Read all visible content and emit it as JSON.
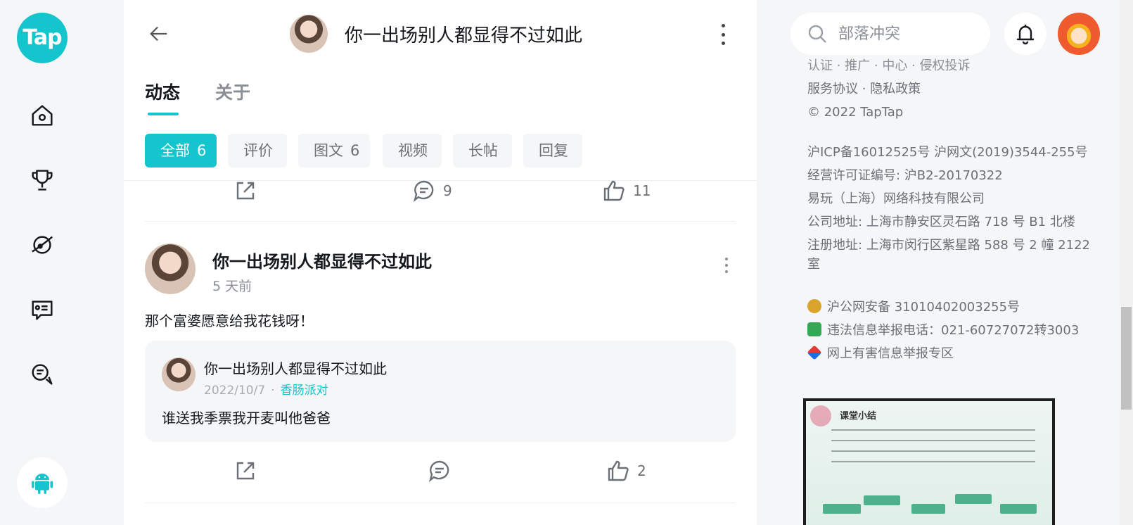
{
  "rail": {
    "logo_text": "Tap",
    "items": [
      {
        "icon": "home-icon"
      },
      {
        "icon": "trophy-icon"
      },
      {
        "icon": "planet-icon"
      },
      {
        "icon": "message-card-icon"
      },
      {
        "icon": "chat-bubbles-icon"
      }
    ],
    "download_icon": "android-icon"
  },
  "header": {
    "title": "你一出场别人都显得不过如此"
  },
  "tabs": [
    {
      "label": "动态",
      "active": true
    },
    {
      "label": "关于",
      "active": false
    }
  ],
  "filters": [
    {
      "label": "全部",
      "count": "6",
      "active": true
    },
    {
      "label": "评价",
      "count": ""
    },
    {
      "label": "图文",
      "count": "6"
    },
    {
      "label": "视频",
      "count": ""
    },
    {
      "label": "长帖",
      "count": ""
    },
    {
      "label": "回复",
      "count": ""
    }
  ],
  "prev_post": {
    "comment_count": "9",
    "like_count": "11"
  },
  "post": {
    "author": "你一出场别人都显得不过如此",
    "time": "5 天前",
    "text": "那个富婆愿意给我花钱呀！",
    "quote": {
      "author": "你一出场别人都显得不过如此",
      "date": "2022/10/7",
      "separator": "·",
      "game": "香肠派对",
      "text": "谁送我季票我开麦叫他爸爸"
    },
    "comment_count": "",
    "like_count": "2"
  },
  "right": {
    "search_placeholder": "部落冲突",
    "footer_cut_line": "认证 · 推广 · 中心 · 侵权投诉",
    "footer_links": "服务协议 · 隐私政策",
    "copyright": "© 2022 TapTap",
    "icp": "沪ICP备16012525号    沪网文(2019)3544-255号",
    "license": "经营许可证编号: 沪B2-20170322",
    "company": "易玩（上海）网络科技有限公司",
    "address1": "公司地址: 上海市静安区灵石路 718 号 B1 北楼",
    "address2_line1": "注册地址: 上海市闵行区紫星路 588 号 2 幢 2122",
    "address2_line2": "室",
    "police": "沪公网安备 31010402003255号",
    "report_phone": "违法信息举报电话：021-60727072转3003",
    "report_zone": "网上有害信息举报专区",
    "promo_title": "课堂小结"
  }
}
